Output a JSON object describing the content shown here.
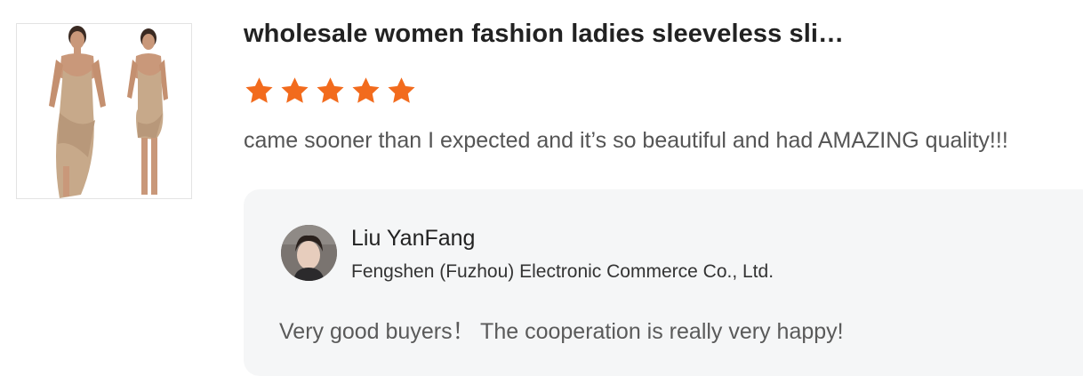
{
  "product": {
    "title": "wholesale women fashion ladies sleeveless sli…",
    "image_alt": "beige wrap dress product image"
  },
  "rating": {
    "stars": 5,
    "max": 5,
    "star_color": "#f26b1d"
  },
  "review": {
    "text": "came sooner than I expected and it’s so beautiful and had AMAZING quality!!!"
  },
  "seller_reply": {
    "name": "Liu YanFang",
    "company": "Fengshen (Fuzhou) Electronic Commerce Co., Ltd.",
    "text": "Very good buyers！ The cooperation is really very happy!"
  },
  "colors": {
    "reply_background": "#f5f6f7",
    "title": "#222222",
    "review_text": "#555555"
  }
}
